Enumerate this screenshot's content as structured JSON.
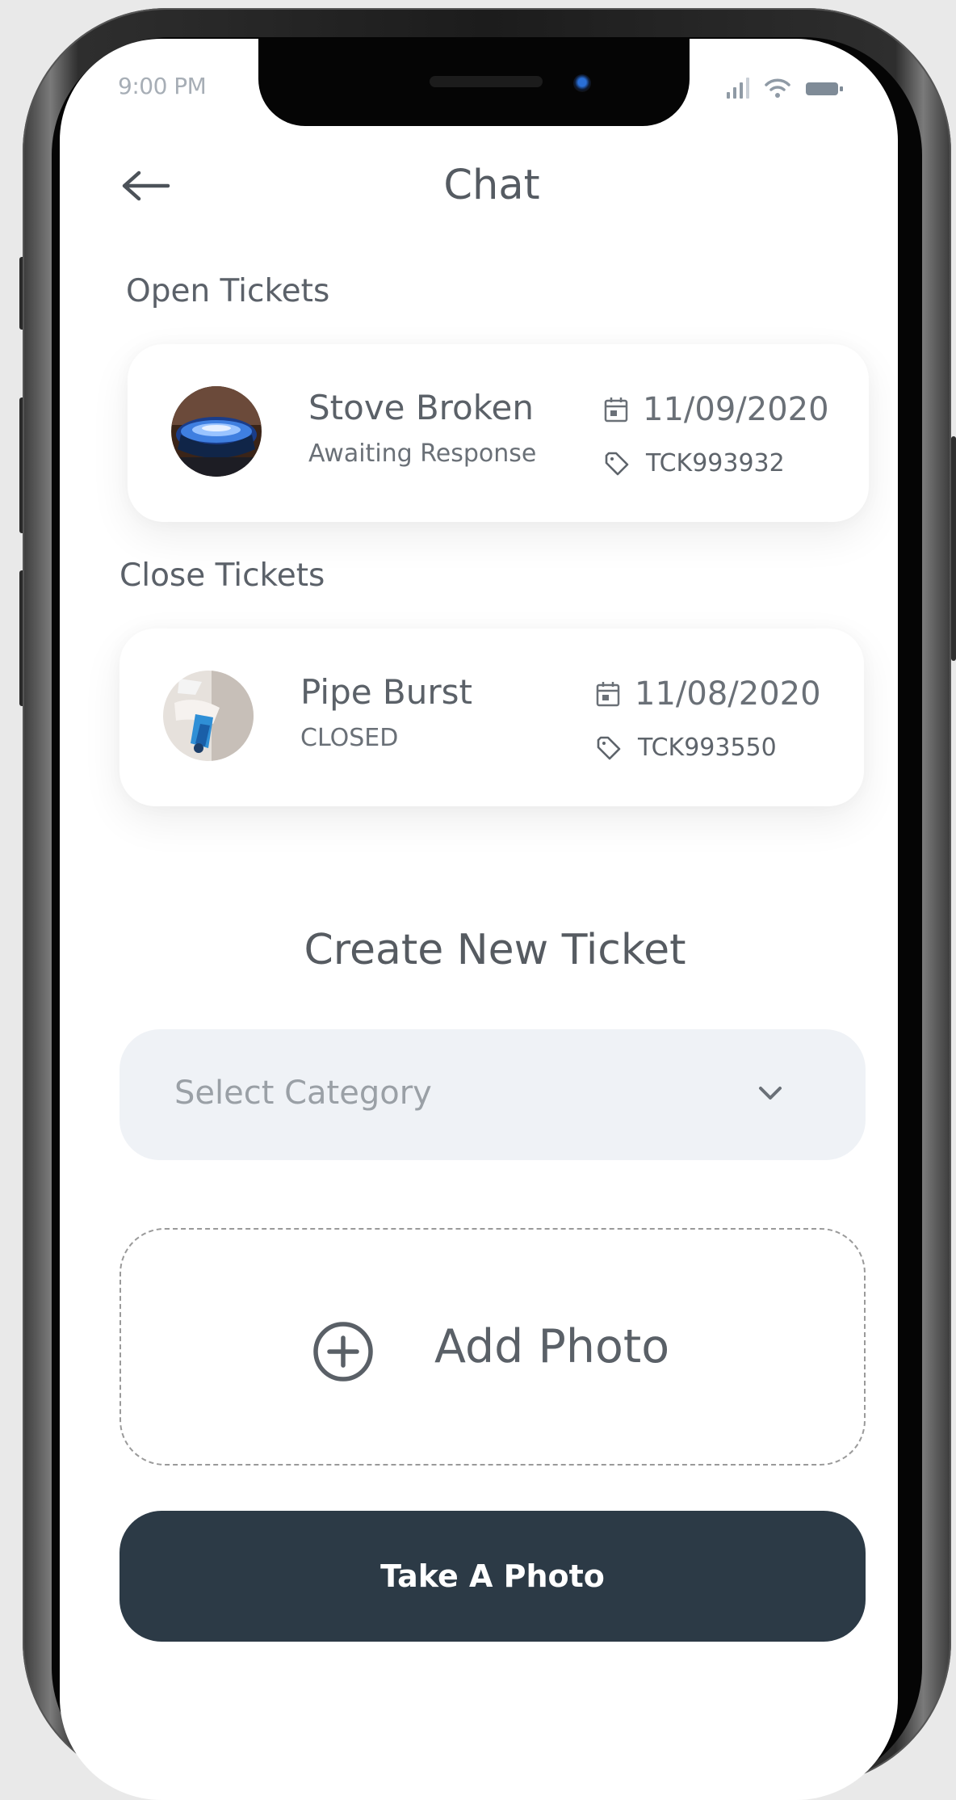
{
  "status_bar": {
    "time": "9:00 PM"
  },
  "header": {
    "title": "Chat",
    "back_icon": "arrow-left-icon"
  },
  "open_tickets": {
    "label": "Open Tickets",
    "items": [
      {
        "name": "Stove Broken",
        "status": "Awaiting Response",
        "date": "11/09/2020",
        "code": "TCK993932",
        "image": "gas-stove-flame"
      }
    ]
  },
  "close_tickets": {
    "label": "Close Tickets",
    "items": [
      {
        "name": "Pipe Burst",
        "status": "CLOSED",
        "date": "11/08/2020",
        "code": "TCK993550",
        "image": "gloved-hand-pipe"
      }
    ]
  },
  "create": {
    "title": "Create New Ticket",
    "category_select": {
      "value": "Select Category",
      "icon": "chevron-down-icon"
    },
    "add_photo": {
      "label": "Add Photo",
      "icon": "plus-circle-icon"
    },
    "take_photo_button": "Take A Photo"
  },
  "colors": {
    "accent_dark": "#2c3a46",
    "select_background": "#eff2f6",
    "text_primary": "#5b6168"
  }
}
